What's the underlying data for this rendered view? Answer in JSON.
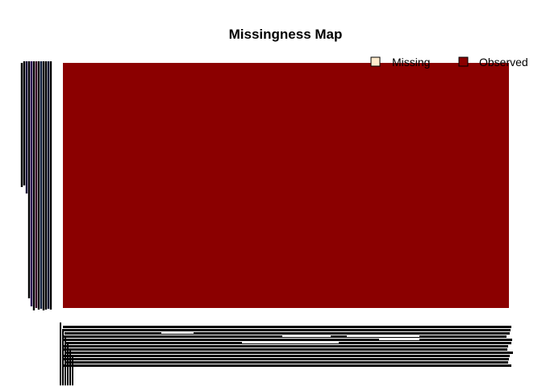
{
  "chart_data": {
    "type": "heatmap",
    "title": "Missingness Map",
    "legend": {
      "placement": "top-right",
      "entries": [
        {
          "label": "Missing",
          "color": "#FFEBCD"
        },
        {
          "label": "Observed",
          "color": "#8B0000"
        }
      ]
    },
    "xlabel": "",
    "ylabel": "",
    "missing_fraction": 0,
    "observed_fraction": 1,
    "colors": {
      "missing": "#FFEBCD",
      "observed": "#8B0000",
      "label_ink": "#000000"
    }
  }
}
